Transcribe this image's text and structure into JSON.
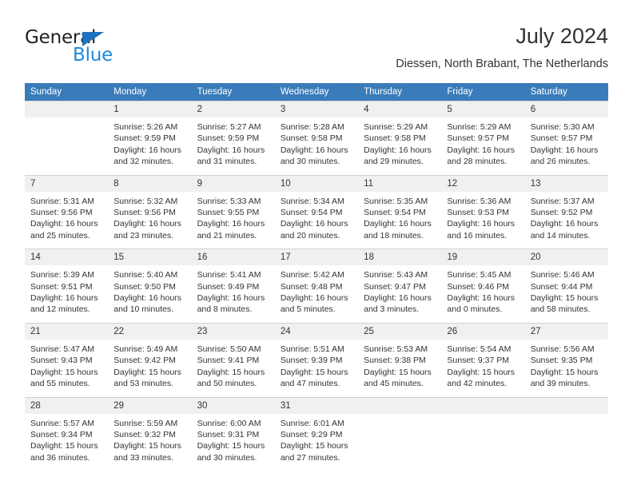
{
  "brand": {
    "name_part1": "General",
    "name_part2": "Blue",
    "triangle_icon": "triangle-icon",
    "color_dark": "#231f20",
    "color_blue": "#1f87d8"
  },
  "header": {
    "title": "July 2024",
    "subtitle": "Diessen, North Brabant, The Netherlands",
    "header_bg": "#3a7cba",
    "daynum_bg": "#f0f0f0"
  },
  "weekdays": [
    "Sunday",
    "Monday",
    "Tuesday",
    "Wednesday",
    "Thursday",
    "Friday",
    "Saturday"
  ],
  "weeks": [
    [
      {
        "day": "",
        "lines": [
          "",
          "",
          "",
          ""
        ],
        "empty": true
      },
      {
        "day": "1",
        "lines": [
          "Sunrise: 5:26 AM",
          "Sunset: 9:59 PM",
          "Daylight: 16 hours",
          "and 32 minutes."
        ]
      },
      {
        "day": "2",
        "lines": [
          "Sunrise: 5:27 AM",
          "Sunset: 9:59 PM",
          "Daylight: 16 hours",
          "and 31 minutes."
        ]
      },
      {
        "day": "3",
        "lines": [
          "Sunrise: 5:28 AM",
          "Sunset: 9:58 PM",
          "Daylight: 16 hours",
          "and 30 minutes."
        ]
      },
      {
        "day": "4",
        "lines": [
          "Sunrise: 5:29 AM",
          "Sunset: 9:58 PM",
          "Daylight: 16 hours",
          "and 29 minutes."
        ]
      },
      {
        "day": "5",
        "lines": [
          "Sunrise: 5:29 AM",
          "Sunset: 9:57 PM",
          "Daylight: 16 hours",
          "and 28 minutes."
        ]
      },
      {
        "day": "6",
        "lines": [
          "Sunrise: 5:30 AM",
          "Sunset: 9:57 PM",
          "Daylight: 16 hours",
          "and 26 minutes."
        ]
      }
    ],
    [
      {
        "day": "7",
        "lines": [
          "Sunrise: 5:31 AM",
          "Sunset: 9:56 PM",
          "Daylight: 16 hours",
          "and 25 minutes."
        ]
      },
      {
        "day": "8",
        "lines": [
          "Sunrise: 5:32 AM",
          "Sunset: 9:56 PM",
          "Daylight: 16 hours",
          "and 23 minutes."
        ]
      },
      {
        "day": "9",
        "lines": [
          "Sunrise: 5:33 AM",
          "Sunset: 9:55 PM",
          "Daylight: 16 hours",
          "and 21 minutes."
        ]
      },
      {
        "day": "10",
        "lines": [
          "Sunrise: 5:34 AM",
          "Sunset: 9:54 PM",
          "Daylight: 16 hours",
          "and 20 minutes."
        ]
      },
      {
        "day": "11",
        "lines": [
          "Sunrise: 5:35 AM",
          "Sunset: 9:54 PM",
          "Daylight: 16 hours",
          "and 18 minutes."
        ]
      },
      {
        "day": "12",
        "lines": [
          "Sunrise: 5:36 AM",
          "Sunset: 9:53 PM",
          "Daylight: 16 hours",
          "and 16 minutes."
        ]
      },
      {
        "day": "13",
        "lines": [
          "Sunrise: 5:37 AM",
          "Sunset: 9:52 PM",
          "Daylight: 16 hours",
          "and 14 minutes."
        ]
      }
    ],
    [
      {
        "day": "14",
        "lines": [
          "Sunrise: 5:39 AM",
          "Sunset: 9:51 PM",
          "Daylight: 16 hours",
          "and 12 minutes."
        ]
      },
      {
        "day": "15",
        "lines": [
          "Sunrise: 5:40 AM",
          "Sunset: 9:50 PM",
          "Daylight: 16 hours",
          "and 10 minutes."
        ]
      },
      {
        "day": "16",
        "lines": [
          "Sunrise: 5:41 AM",
          "Sunset: 9:49 PM",
          "Daylight: 16 hours",
          "and 8 minutes."
        ]
      },
      {
        "day": "17",
        "lines": [
          "Sunrise: 5:42 AM",
          "Sunset: 9:48 PM",
          "Daylight: 16 hours",
          "and 5 minutes."
        ]
      },
      {
        "day": "18",
        "lines": [
          "Sunrise: 5:43 AM",
          "Sunset: 9:47 PM",
          "Daylight: 16 hours",
          "and 3 minutes."
        ]
      },
      {
        "day": "19",
        "lines": [
          "Sunrise: 5:45 AM",
          "Sunset: 9:46 PM",
          "Daylight: 16 hours",
          "and 0 minutes."
        ]
      },
      {
        "day": "20",
        "lines": [
          "Sunrise: 5:46 AM",
          "Sunset: 9:44 PM",
          "Daylight: 15 hours",
          "and 58 minutes."
        ]
      }
    ],
    [
      {
        "day": "21",
        "lines": [
          "Sunrise: 5:47 AM",
          "Sunset: 9:43 PM",
          "Daylight: 15 hours",
          "and 55 minutes."
        ]
      },
      {
        "day": "22",
        "lines": [
          "Sunrise: 5:49 AM",
          "Sunset: 9:42 PM",
          "Daylight: 15 hours",
          "and 53 minutes."
        ]
      },
      {
        "day": "23",
        "lines": [
          "Sunrise: 5:50 AM",
          "Sunset: 9:41 PM",
          "Daylight: 15 hours",
          "and 50 minutes."
        ]
      },
      {
        "day": "24",
        "lines": [
          "Sunrise: 5:51 AM",
          "Sunset: 9:39 PM",
          "Daylight: 15 hours",
          "and 47 minutes."
        ]
      },
      {
        "day": "25",
        "lines": [
          "Sunrise: 5:53 AM",
          "Sunset: 9:38 PM",
          "Daylight: 15 hours",
          "and 45 minutes."
        ]
      },
      {
        "day": "26",
        "lines": [
          "Sunrise: 5:54 AM",
          "Sunset: 9:37 PM",
          "Daylight: 15 hours",
          "and 42 minutes."
        ]
      },
      {
        "day": "27",
        "lines": [
          "Sunrise: 5:56 AM",
          "Sunset: 9:35 PM",
          "Daylight: 15 hours",
          "and 39 minutes."
        ]
      }
    ],
    [
      {
        "day": "28",
        "lines": [
          "Sunrise: 5:57 AM",
          "Sunset: 9:34 PM",
          "Daylight: 15 hours",
          "and 36 minutes."
        ]
      },
      {
        "day": "29",
        "lines": [
          "Sunrise: 5:59 AM",
          "Sunset: 9:32 PM",
          "Daylight: 15 hours",
          "and 33 minutes."
        ]
      },
      {
        "day": "30",
        "lines": [
          "Sunrise: 6:00 AM",
          "Sunset: 9:31 PM",
          "Daylight: 15 hours",
          "and 30 minutes."
        ]
      },
      {
        "day": "31",
        "lines": [
          "Sunrise: 6:01 AM",
          "Sunset: 9:29 PM",
          "Daylight: 15 hours",
          "and 27 minutes."
        ]
      },
      {
        "day": "",
        "lines": [
          "",
          "",
          "",
          ""
        ],
        "empty": true
      },
      {
        "day": "",
        "lines": [
          "",
          "",
          "",
          ""
        ],
        "empty": true
      },
      {
        "day": "",
        "lines": [
          "",
          "",
          "",
          ""
        ],
        "empty": true
      }
    ]
  ]
}
